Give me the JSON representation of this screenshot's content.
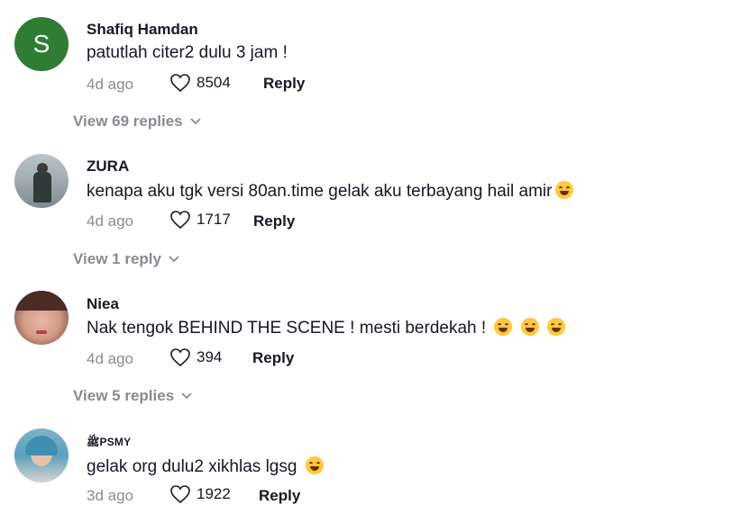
{
  "comments": [
    {
      "name": "Shafiq Hamdan",
      "avatar_letter": "S",
      "text": "patutlah citer2 dulu 3 jam !",
      "time": "4d ago",
      "likes": "8504",
      "reply_label": "Reply",
      "view_replies": "View 69 replies"
    },
    {
      "name": "ZURA",
      "text": "kenapa aku tgk versi 80an.time gelak aku terbayang hail amir",
      "time": "4d ago",
      "likes": "1717",
      "reply_label": "Reply",
      "view_replies": "View 1 reply"
    },
    {
      "name": "Niea",
      "text": "Nak tengok BEHIND THE SCENE ! mesti berdekah !",
      "time": "4d ago",
      "likes": "394",
      "reply_label": "Reply",
      "view_replies": "View 5 replies"
    },
    {
      "name": "ﷺPSMY",
      "text": "gelak org dulu2 xikhlas lgsg",
      "time": "3d ago",
      "likes": "1922",
      "reply_label": "Reply"
    }
  ],
  "colors": {
    "primary_text": "#161823",
    "secondary_text": "#8a8b91",
    "avatar_green": "#2e7d32"
  },
  "icons": {
    "like": "heart-outline-icon",
    "expand": "chevron-down-icon",
    "emoji": "laughing-emoji-icon"
  }
}
